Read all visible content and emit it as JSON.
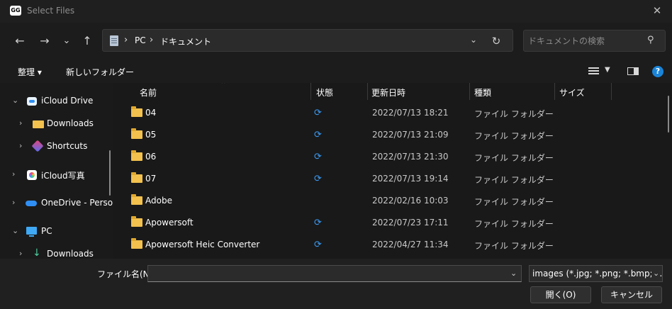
{
  "window": {
    "app_icon_text": "GG",
    "title": "Select Files",
    "close_glyph": "✕"
  },
  "nav": {
    "back": "←",
    "forward": "→",
    "recent": "⌄",
    "up": "↑",
    "breadcrumbs": [
      "PC",
      "ドキュメント"
    ],
    "crumb_sep": "›",
    "dropdown": "⌄",
    "refresh": "↻",
    "search_placeholder": "ドキュメントの検索",
    "search_glyph": "⚲"
  },
  "toolbar": {
    "organize": "整理 ▾",
    "new_folder": "新しいフォルダー",
    "help": "?"
  },
  "sidebar": {
    "items": [
      {
        "label": "iCloud Drive",
        "chevron": "⌄",
        "icon": "icloud-icon"
      },
      {
        "label": "Downloads",
        "chevron": "›",
        "icon": "folder-icon"
      },
      {
        "label": "Shortcuts",
        "chevron": "›",
        "icon": "shortcuts-icon"
      },
      {
        "label": "iCloud写真",
        "chevron": "›",
        "icon": "photos-icon"
      },
      {
        "label": "OneDrive - Perso",
        "chevron": "›",
        "icon": "onedrive-icon"
      },
      {
        "label": "PC",
        "chevron": "⌄",
        "icon": "pc-icon"
      },
      {
        "label": "Downloads",
        "chevron": "›",
        "icon": "download-arrow-icon"
      }
    ]
  },
  "columns": {
    "name": "名前",
    "status": "状態",
    "modified": "更新日時",
    "type": "種類",
    "size": "サイズ",
    "sort_caret": "⌃"
  },
  "files": [
    {
      "name": "04",
      "synced": true,
      "modified": "2022/07/13 18:21",
      "type": "ファイル フォルダー"
    },
    {
      "name": "05",
      "synced": true,
      "modified": "2022/07/13 21:09",
      "type": "ファイル フォルダー"
    },
    {
      "name": "06",
      "synced": true,
      "modified": "2022/07/13 21:30",
      "type": "ファイル フォルダー"
    },
    {
      "name": "07",
      "synced": true,
      "modified": "2022/07/13 19:14",
      "type": "ファイル フォルダー"
    },
    {
      "name": "Adobe",
      "synced": false,
      "modified": "2022/02/16 10:03",
      "type": "ファイル フォルダー"
    },
    {
      "name": "Apowersoft",
      "synced": true,
      "modified": "2022/07/23 17:11",
      "type": "ファイル フォルダー"
    },
    {
      "name": "Apowersoft Heic Converter",
      "synced": true,
      "modified": "2022/04/27 11:34",
      "type": "ファイル フォルダー"
    }
  ],
  "sync_glyph": "⟳",
  "bottom": {
    "filename_label": "ファイル名(N):",
    "filename_value": "",
    "filename_chevron": "⌄",
    "filter": "images (*.jpg; *.png; *.bmp; *.jp",
    "filter_chevron": "⌄",
    "open": "開く(O)",
    "cancel": "キャンセル"
  },
  "colors": {
    "accent": "#3a9bf5",
    "folder": "#f2c14e",
    "help": "#1a84d8"
  }
}
